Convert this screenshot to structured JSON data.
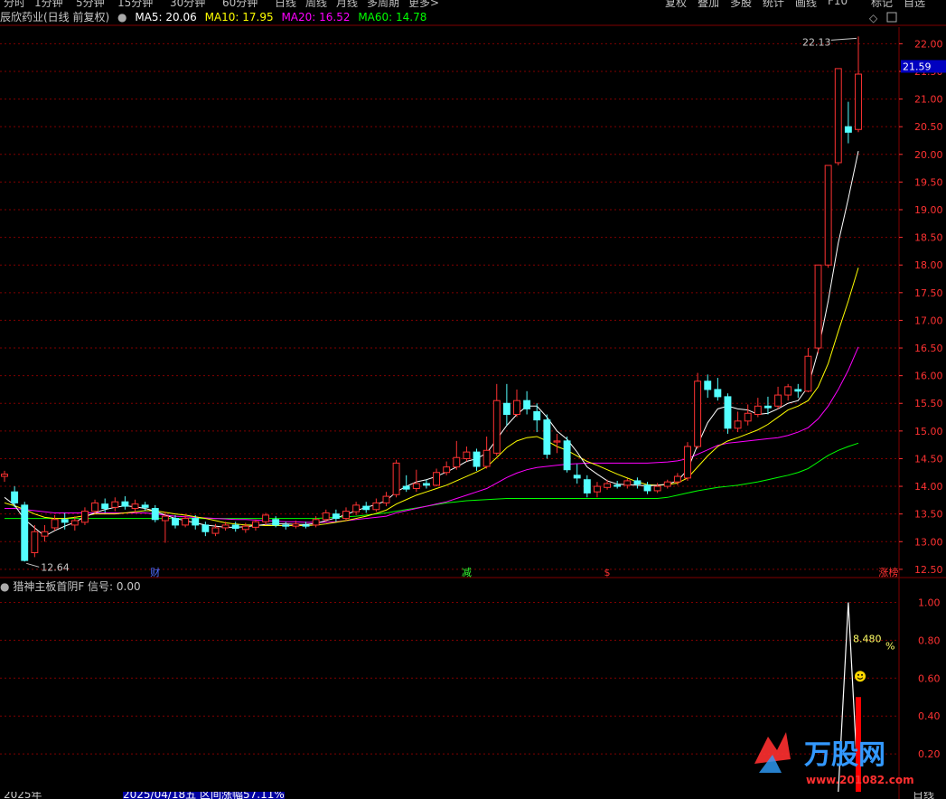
{
  "top_nav": {
    "left_items": [
      "分时",
      "1分钟",
      "5分钟",
      "15分钟",
      "30分钟",
      "60分钟",
      "日线",
      "周线",
      "月线",
      "多周期",
      "更多>"
    ],
    "right_items": [
      "复权",
      "叠加",
      "多股",
      "统计",
      "画线",
      "F10",
      "标记",
      "自选"
    ]
  },
  "header": {
    "stock_name": "辰欣药业(日线 前复权)",
    "ma5_label": "MA5: 20.06",
    "ma10_label": "MA10: 17.95",
    "ma20_label": "MA20: 16.52",
    "ma60_label": "MA60: 14.78"
  },
  "colors": {
    "up": "#ff3232",
    "down": "#54ffff",
    "ma5": "#ffffff",
    "ma10": "#ffff00",
    "ma20": "#ff00ff",
    "ma60": "#00ff00",
    "grid": "#800000",
    "axis_text": "#ff3232"
  },
  "chart_data": [
    {
      "type": "candlestick",
      "y_ticks": [
        22.0,
        21.5,
        21.0,
        20.5,
        20.0,
        19.5,
        19.0,
        18.5,
        18.0,
        17.5,
        17.0,
        16.5,
        16.0,
        15.5,
        15.0,
        14.5,
        14.0,
        13.5,
        13.0,
        12.5
      ],
      "ylim": [
        12.4,
        22.3
      ],
      "current_price": "21.59",
      "high_annotation": "22.13",
      "low_annotation": "12.64",
      "event_markers": [
        {
          "label": "财",
          "index": 15,
          "color": "#4c6cff"
        },
        {
          "label": "减",
          "index": 46,
          "color": "#32ff32"
        },
        {
          "label": "$",
          "index": 60,
          "color": "#ff3232"
        },
        {
          "label": "涨榜",
          "index": 88,
          "color": "#ff3232"
        }
      ],
      "candles": [
        [
          14.18,
          14.22,
          14.28,
          14.08
        ],
        [
          13.9,
          13.7,
          14.0,
          13.62
        ],
        [
          13.66,
          12.66,
          13.72,
          12.64
        ],
        [
          12.8,
          13.18,
          13.3,
          12.72
        ],
        [
          13.1,
          13.18,
          13.3,
          13.0
        ],
        [
          13.25,
          13.4,
          13.48,
          13.2
        ],
        [
          13.4,
          13.35,
          13.52,
          13.22
        ],
        [
          13.3,
          13.38,
          13.46,
          13.2
        ],
        [
          13.35,
          13.55,
          13.62,
          13.3
        ],
        [
          13.55,
          13.7,
          13.76,
          13.5
        ],
        [
          13.68,
          13.6,
          13.78,
          13.52
        ],
        [
          13.62,
          13.72,
          13.8,
          13.55
        ],
        [
          13.72,
          13.64,
          13.82,
          13.58
        ],
        [
          13.6,
          13.68,
          13.76,
          13.52
        ],
        [
          13.66,
          13.62,
          13.72,
          13.56
        ],
        [
          13.6,
          13.4,
          13.66,
          13.35
        ],
        [
          13.38,
          13.46,
          13.54,
          12.98
        ],
        [
          13.42,
          13.3,
          13.48,
          13.24
        ],
        [
          13.3,
          13.42,
          13.5,
          13.26
        ],
        [
          13.42,
          13.3,
          13.48,
          13.22
        ],
        [
          13.3,
          13.18,
          13.36,
          13.1
        ],
        [
          13.15,
          13.25,
          13.32,
          13.1
        ],
        [
          13.25,
          13.3,
          13.36,
          13.2
        ],
        [
          13.3,
          13.24,
          13.36,
          13.18
        ],
        [
          13.22,
          13.28,
          13.34,
          13.16
        ],
        [
          13.26,
          13.36,
          13.4,
          13.2
        ],
        [
          13.36,
          13.48,
          13.52,
          13.3
        ],
        [
          13.4,
          13.3,
          13.46,
          13.26
        ],
        [
          13.3,
          13.28,
          13.36,
          13.22
        ],
        [
          13.28,
          13.32,
          13.38,
          13.24
        ],
        [
          13.3,
          13.28,
          13.36,
          13.24
        ],
        [
          13.3,
          13.4,
          13.46,
          13.26
        ],
        [
          13.4,
          13.52,
          13.58,
          13.36
        ],
        [
          13.5,
          13.42,
          13.58,
          13.36
        ],
        [
          13.42,
          13.55,
          13.62,
          13.38
        ],
        [
          13.54,
          13.66,
          13.72,
          13.48
        ],
        [
          13.64,
          13.58,
          13.72,
          13.52
        ],
        [
          13.58,
          13.7,
          13.78,
          13.54
        ],
        [
          13.7,
          13.82,
          13.9,
          13.64
        ],
        [
          13.85,
          14.42,
          14.48,
          13.8
        ],
        [
          14.0,
          13.95,
          14.2,
          13.9
        ],
        [
          13.96,
          14.05,
          14.3,
          13.9
        ],
        [
          14.05,
          14.02,
          14.12,
          13.96
        ],
        [
          14.02,
          14.25,
          14.32,
          14.0
        ],
        [
          14.25,
          14.35,
          14.45,
          14.2
        ],
        [
          14.35,
          14.52,
          14.82,
          14.3
        ],
        [
          14.5,
          14.62,
          14.72,
          14.45
        ],
        [
          14.62,
          14.36,
          14.68,
          14.28
        ],
        [
          14.36,
          14.65,
          14.9,
          14.32
        ],
        [
          14.6,
          15.55,
          15.85,
          14.55
        ],
        [
          15.5,
          15.3,
          15.85,
          15.1
        ],
        [
          15.3,
          15.55,
          15.75,
          15.25
        ],
        [
          15.55,
          15.4,
          15.72,
          15.3
        ],
        [
          15.35,
          15.2,
          15.5,
          14.98
        ],
        [
          15.2,
          14.58,
          15.3,
          14.5
        ],
        [
          14.8,
          14.82,
          14.95,
          14.6
        ],
        [
          14.82,
          14.3,
          14.9,
          14.25
        ],
        [
          14.2,
          14.15,
          14.4,
          14.05
        ],
        [
          14.12,
          13.88,
          14.2,
          13.8
        ],
        [
          13.9,
          14.0,
          14.08,
          13.8
        ],
        [
          13.98,
          14.05,
          14.12,
          13.94
        ],
        [
          14.02,
          14.0,
          14.1,
          13.96
        ],
        [
          14.02,
          14.1,
          14.14,
          13.96
        ],
        [
          14.1,
          14.04,
          14.16,
          13.96
        ],
        [
          14.02,
          13.92,
          14.08,
          13.86
        ],
        [
          13.92,
          14.0,
          14.06,
          13.88
        ],
        [
          14.0,
          14.08,
          14.12,
          13.96
        ],
        [
          14.08,
          14.18,
          14.24,
          14.02
        ],
        [
          14.15,
          14.72,
          14.8,
          14.1
        ],
        [
          14.72,
          15.9,
          16.05,
          14.68
        ],
        [
          15.9,
          15.75,
          16.02,
          15.6
        ],
        [
          15.75,
          15.62,
          15.96,
          15.55
        ],
        [
          15.62,
          15.05,
          15.68,
          14.95
        ],
        [
          15.05,
          15.18,
          15.35,
          14.98
        ],
        [
          15.18,
          15.32,
          15.48,
          15.1
        ],
        [
          15.3,
          15.45,
          15.6,
          15.25
        ],
        [
          15.45,
          15.42,
          15.62,
          15.3
        ],
        [
          15.45,
          15.65,
          15.8,
          15.4
        ],
        [
          15.65,
          15.8,
          15.85,
          15.55
        ],
        [
          15.75,
          15.72,
          15.85,
          15.6
        ],
        [
          15.72,
          16.35,
          16.5,
          15.7
        ],
        [
          16.5,
          18.0,
          18.0,
          16.4
        ],
        [
          18.0,
          19.8,
          19.8,
          17.95
        ],
        [
          19.85,
          21.55,
          21.55,
          19.8
        ],
        [
          20.5,
          20.4,
          20.95,
          20.2
        ],
        [
          20.45,
          21.45,
          22.13,
          20.4
        ]
      ],
      "ma5": [
        13.8,
        13.66,
        13.4,
        13.25,
        13.1,
        13.2,
        13.28,
        13.35,
        13.45,
        13.52,
        13.58,
        13.62,
        13.65,
        13.63,
        13.6,
        13.55,
        13.48,
        13.42,
        13.38,
        13.34,
        13.3,
        13.28,
        13.26,
        13.26,
        13.27,
        13.29,
        13.31,
        13.32,
        13.32,
        13.31,
        13.31,
        13.33,
        13.38,
        13.43,
        13.49,
        13.56,
        13.62,
        13.67,
        13.74,
        13.9,
        14.0,
        14.08,
        14.12,
        14.18,
        14.26,
        14.35,
        14.45,
        14.5,
        14.6,
        14.85,
        15.1,
        15.3,
        15.45,
        15.45,
        15.25,
        15.0,
        14.85,
        14.62,
        14.35,
        14.22,
        14.1,
        14.04,
        14.03,
        14.02,
        14.01,
        14.02,
        14.04,
        14.1,
        14.3,
        14.75,
        15.15,
        15.4,
        15.45,
        15.4,
        15.38,
        15.3,
        15.32,
        15.4,
        15.5,
        15.55,
        15.8,
        16.45,
        17.35,
        18.4,
        19.2,
        20.06
      ],
      "ma10": [
        13.7,
        13.65,
        13.58,
        13.5,
        13.44,
        13.42,
        13.42,
        13.44,
        13.47,
        13.5,
        13.5,
        13.5,
        13.52,
        13.54,
        13.56,
        13.56,
        13.53,
        13.5,
        13.48,
        13.45,
        13.42,
        13.38,
        13.34,
        13.32,
        13.3,
        13.3,
        13.29,
        13.29,
        13.29,
        13.29,
        13.29,
        13.3,
        13.32,
        13.35,
        13.38,
        13.42,
        13.46,
        13.51,
        13.57,
        13.68,
        13.76,
        13.84,
        13.9,
        13.96,
        14.02,
        14.1,
        14.18,
        14.26,
        14.35,
        14.52,
        14.7,
        14.82,
        14.88,
        14.9,
        14.82,
        14.72,
        14.65,
        14.55,
        14.45,
        14.38,
        14.3,
        14.22,
        14.15,
        14.08,
        14.03,
        14.02,
        14.03,
        14.06,
        14.15,
        14.35,
        14.55,
        14.72,
        14.82,
        14.88,
        14.95,
        15.02,
        15.12,
        15.25,
        15.38,
        15.45,
        15.55,
        15.8,
        16.22,
        16.8,
        17.35,
        17.95
      ],
      "ma20": [
        13.6,
        13.6,
        13.58,
        13.56,
        13.54,
        13.52,
        13.52,
        13.52,
        13.52,
        13.52,
        13.52,
        13.52,
        13.52,
        13.52,
        13.52,
        13.5,
        13.48,
        13.46,
        13.45,
        13.44,
        13.43,
        13.42,
        13.41,
        13.4,
        13.4,
        13.39,
        13.38,
        13.37,
        13.36,
        13.36,
        13.35,
        13.35,
        13.35,
        13.36,
        13.38,
        13.4,
        13.42,
        13.44,
        13.46,
        13.52,
        13.56,
        13.6,
        13.64,
        13.68,
        13.72,
        13.78,
        13.84,
        13.9,
        13.96,
        14.06,
        14.16,
        14.24,
        14.3,
        14.34,
        14.36,
        14.38,
        14.4,
        14.41,
        14.42,
        14.42,
        14.42,
        14.42,
        14.42,
        14.42,
        14.42,
        14.43,
        14.44,
        14.46,
        14.5,
        14.58,
        14.66,
        14.74,
        14.78,
        14.8,
        14.82,
        14.84,
        14.86,
        14.88,
        14.92,
        14.98,
        15.06,
        15.22,
        15.45,
        15.75,
        16.1,
        16.52
      ],
      "ma60": [
        13.42,
        13.42,
        13.42,
        13.42,
        13.42,
        13.42,
        13.42,
        13.42,
        13.42,
        13.42,
        13.42,
        13.42,
        13.42,
        13.42,
        13.42,
        13.42,
        13.42,
        13.42,
        13.42,
        13.42,
        13.42,
        13.42,
        13.42,
        13.42,
        13.42,
        13.42,
        13.42,
        13.42,
        13.42,
        13.42,
        13.42,
        13.42,
        13.43,
        13.44,
        13.45,
        13.46,
        13.48,
        13.5,
        13.52,
        13.55,
        13.58,
        13.61,
        13.64,
        13.67,
        13.7,
        13.72,
        13.74,
        13.75,
        13.76,
        13.77,
        13.78,
        13.78,
        13.78,
        13.78,
        13.78,
        13.78,
        13.78,
        13.78,
        13.78,
        13.78,
        13.78,
        13.78,
        13.78,
        13.78,
        13.78,
        13.78,
        13.8,
        13.84,
        13.88,
        13.92,
        13.95,
        13.98,
        14.0,
        14.02,
        14.05,
        14.08,
        14.12,
        14.16,
        14.2,
        14.25,
        14.32,
        14.44,
        14.56,
        14.65,
        14.72,
        14.78
      ]
    },
    {
      "type": "line",
      "title": "猎神主板首阴F 信号: 0.00",
      "y_ticks": [
        1.0,
        0.8,
        0.6,
        0.4,
        0.2
      ],
      "ylim": [
        0.0,
        1.05
      ],
      "signal_points": [
        {
          "index": 83,
          "value": 0.0
        },
        {
          "index": 84,
          "value": 1.0
        },
        {
          "index": 85,
          "value": 0.0
        }
      ],
      "bar": {
        "index": 85,
        "value": 0.5
      },
      "value_label": "8.480",
      "percent_label": "%"
    }
  ],
  "bottom_bar": {
    "left": "2025年",
    "mid": "2025/04/18五 区间涨幅57.11%",
    "right": "日线"
  },
  "watermark": {
    "text": "万股网",
    "url": "www.201082.com"
  }
}
